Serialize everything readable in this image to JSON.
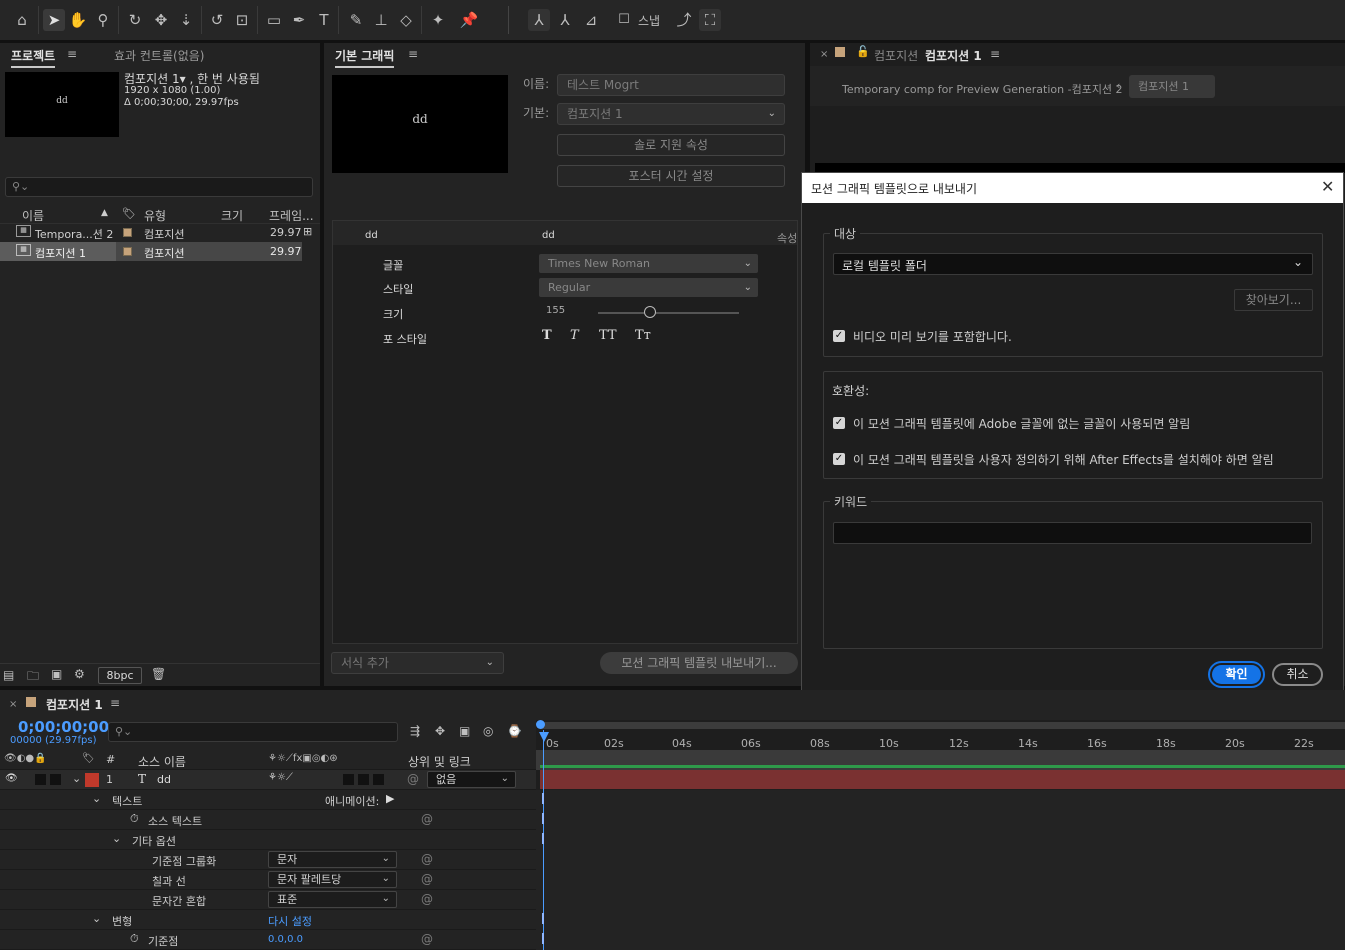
{
  "colors": {
    "accent": "#1473e6",
    "time_blue": "#4b9cff",
    "label_red": "#c0392b",
    "layer_bar": "#7a3131",
    "green_bar": "#2e9a4a"
  },
  "toolbar": {
    "icons": [
      "home-icon",
      "selection-tool-icon",
      "hand-tool-icon",
      "zoom-tool-icon",
      "orbit-camera-icon",
      "pan-camera-icon",
      "dolly-camera-icon",
      "rotate-tool-icon",
      "pan-behind-icon",
      "rectangle-tool-icon",
      "pen-tool-icon",
      "type-tool-icon",
      "brush-tool-icon",
      "clone-stamp-icon",
      "eraser-tool-icon",
      "roto-brush-icon",
      "puppet-pin-icon"
    ],
    "snap_label": "스냅"
  },
  "project": {
    "tab_project": "프로젝트",
    "tab_effects": "효과 컨트롤(없음)",
    "thumb_text": "dd",
    "comp_name": "컴포지션 1▾ , 한 번 사용됨",
    "comp_size": "1920 x 1080 (1.00)",
    "comp_duration": "Δ 0;00;30;00, 29.97fps",
    "search_placeholder": "",
    "columns": {
      "name": "이름",
      "type": "유형",
      "size": "크기",
      "frame": "프레임..."
    },
    "rows": [
      {
        "name": "Tempora...션 2",
        "type": "컴포지션",
        "fps": "29.97"
      },
      {
        "name": "컴포지션 1",
        "type": "컴포지션",
        "fps": "29.97"
      }
    ],
    "bpc": "8bpc"
  },
  "eg": {
    "tab": "기본 그래픽",
    "thumb_text": "dd",
    "name_label": "이름:",
    "name_placeholder": "테스트 Mogrt",
    "master_label": "기본:",
    "master_value": "컴포지션 1",
    "solo_btn": "솔로 지원 속성",
    "poster_btn": "포스터 시간 설정",
    "layer_name": "dd",
    "layer_name2": "dd",
    "props_label": "속성",
    "font_label": "글꼴",
    "font_value": "Times New Roman",
    "style_label": "스타일",
    "style_value": "Regular",
    "size_label": "크기",
    "size_value": "155",
    "fontstyle_label": "포 스타일",
    "fontstyle_glyphs": [
      "T",
      "T",
      "TT",
      "Tт"
    ],
    "add_format": "서식 추가",
    "export_btn": "모션 그래픽 템플릿 내보내기..."
  },
  "comp": {
    "tab_prefix": "컴포지션",
    "tab_name": "컴포지션 1",
    "breadcrumb1": "Temporary comp for Preview Generation -컴포지션 2",
    "breadcrumb2": "컴포지션 1"
  },
  "dialog": {
    "title": "모션 그래픽 템플릿으로 내보내기",
    "dest_group": "대상",
    "dest_value": "로컬 템플릿 폴더",
    "browse_btn": "찾아보기...",
    "include_video": "비디오 미리 보기를 포함합니다.",
    "compat_group": "호환성:",
    "compat1": "이 모션 그래픽 템플릿에 Adobe 글꼴에 없는 글꼴이 사용되면 알림",
    "compat2": "이 모션 그래픽 템플릿을 사용자 정의하기 위해 After Effects를 설치해야 하면 알림",
    "keywords_group": "키워드",
    "keywords_value": "",
    "ok_btn": "확인",
    "cancel_btn": "취소"
  },
  "timeline": {
    "tab": "컴포지션 1",
    "timecode": "0;00;00;00",
    "frames": "00000 (29.97fps)",
    "search_placeholder": "",
    "col_num": "#",
    "col_source": "소스 이름",
    "col_parent": "상위 및 링크",
    "layer_num": "1",
    "layer_name": "dd",
    "parent_value": "없음",
    "text_group": "텍스트",
    "animate_label": "애니메이션:",
    "source_text": "소스 텍스트",
    "more_options": "기타 옵션",
    "anchor_group": "기준점 그룹화",
    "anchor_group_value": "문자",
    "fill_stroke": "칠과 선",
    "fill_stroke_value": "문자 팔레트당",
    "blend": "문자간 혼합",
    "blend_value": "표준",
    "transform": "변형",
    "reset": "다시 설정",
    "anchor": "기준점",
    "anchor_value": "0.0,0.0",
    "ruler": [
      "0s",
      "02s",
      "04s",
      "06s",
      "08s",
      "10s",
      "12s",
      "14s",
      "16s",
      "18s",
      "20s",
      "22s"
    ]
  }
}
